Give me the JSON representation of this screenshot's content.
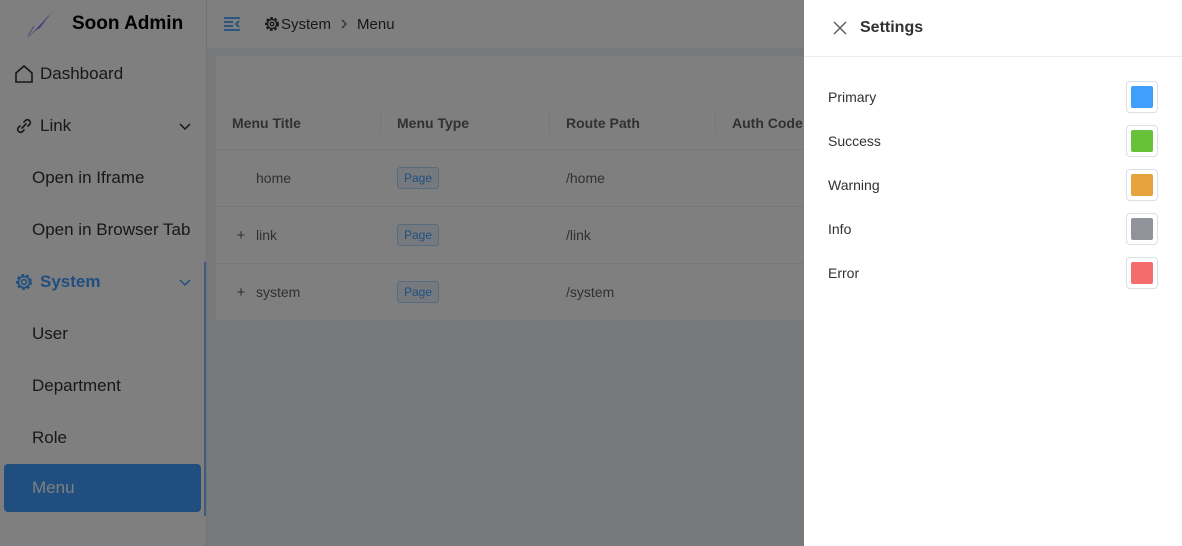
{
  "app": {
    "name": "Soon Admin"
  },
  "sidebar": {
    "items": [
      {
        "label": "Dashboard"
      },
      {
        "label": "Link"
      },
      {
        "label": "Open in Iframe"
      },
      {
        "label": "Open in Browser Tab"
      },
      {
        "label": "System"
      },
      {
        "label": "User"
      },
      {
        "label": "Department"
      },
      {
        "label": "Role"
      },
      {
        "label": "Menu"
      }
    ]
  },
  "breadcrumb": {
    "first": "System",
    "second": "Menu"
  },
  "table": {
    "headers": [
      "Menu Title",
      "Menu Type",
      "Route Path",
      "Auth Code"
    ],
    "rows": [
      {
        "title": "home",
        "type": "Page",
        "path": "/home",
        "expandable": false
      },
      {
        "title": "link",
        "type": "Page",
        "path": "/link",
        "expandable": true
      },
      {
        "title": "system",
        "type": "Page",
        "path": "/system",
        "expandable": true
      }
    ],
    "expand_glyph": "+"
  },
  "settings": {
    "title": "Settings",
    "colors": [
      {
        "label": "Primary",
        "color": "#409eff"
      },
      {
        "label": "Success",
        "color": "#67c23a"
      },
      {
        "label": "Warning",
        "color": "#e6a23c"
      },
      {
        "label": "Info",
        "color": "#909399"
      },
      {
        "label": "Error",
        "color": "#f56c6c"
      }
    ]
  },
  "theme": {
    "accent": "#409eff"
  }
}
